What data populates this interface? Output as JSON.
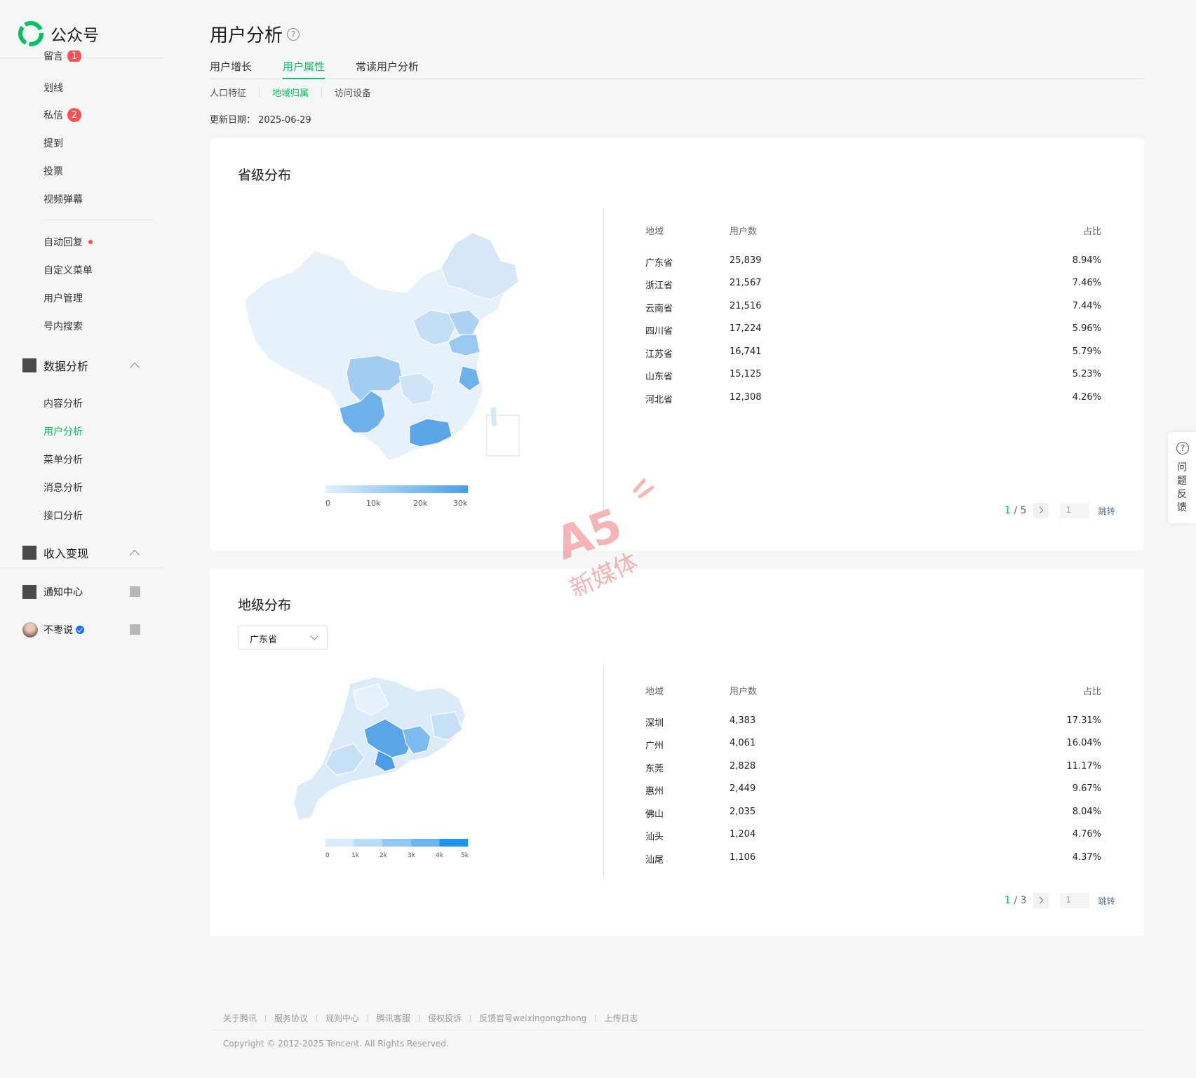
{
  "app": {
    "name": "公众号"
  },
  "sidebar": {
    "items": [
      {
        "label": "留言",
        "badge": "1"
      },
      {
        "label": "划线"
      },
      {
        "label": "私信",
        "badge": "2"
      },
      {
        "label": "提到"
      },
      {
        "label": "投票"
      },
      {
        "label": "视频弹幕"
      },
      {
        "label": "自动回复"
      },
      {
        "label": "自定义菜单"
      },
      {
        "label": "用户管理"
      },
      {
        "label": "号内搜索"
      }
    ],
    "groups": {
      "data_analysis": "数据分析",
      "data_items": [
        "内容分析",
        "用户分析",
        "菜单分析",
        "消息分析",
        "接口分析"
      ],
      "monetize": "收入变现",
      "notice": "通知中心",
      "account": "不枣说"
    }
  },
  "header": {
    "title": "用户分析",
    "help": "?",
    "tabs": [
      "用户增长",
      "用户属性",
      "常读用户分析"
    ],
    "subtabs": [
      "人口特征",
      "地域归属",
      "访问设备"
    ],
    "update_label": "更新日期：",
    "update_date": "2025-06-29"
  },
  "province": {
    "title": "省级分布",
    "columns": [
      "地域",
      "用户数",
      "占比"
    ],
    "rows": [
      {
        "region": "广东省",
        "users": "25,839",
        "pct": "8.94%"
      },
      {
        "region": "浙江省",
        "users": "21,567",
        "pct": "7.46%"
      },
      {
        "region": "云南省",
        "users": "21,516",
        "pct": "7.44%"
      },
      {
        "region": "四川省",
        "users": "17,224",
        "pct": "5.96%"
      },
      {
        "region": "江苏省",
        "users": "16,741",
        "pct": "5.79%"
      },
      {
        "region": "山东省",
        "users": "15,125",
        "pct": "5.23%"
      },
      {
        "region": "河北省",
        "users": "12,308",
        "pct": "4.26%"
      }
    ],
    "legend": [
      "0",
      "10k",
      "20k",
      "30k"
    ],
    "pager": {
      "current": "1",
      "total": "/ 5",
      "input": "1",
      "jump": "跳转"
    }
  },
  "city": {
    "title": "地级分布",
    "select": "广东省",
    "columns": [
      "地域",
      "用户数",
      "占比"
    ],
    "rows": [
      {
        "region": "深圳",
        "users": "4,383",
        "pct": "17.31%"
      },
      {
        "region": "广州",
        "users": "4,061",
        "pct": "16.04%"
      },
      {
        "region": "东莞",
        "users": "2,828",
        "pct": "11.17%"
      },
      {
        "region": "惠州",
        "users": "2,449",
        "pct": "9.67%"
      },
      {
        "region": "佛山",
        "users": "2,035",
        "pct": "8.04%"
      },
      {
        "region": "汕头",
        "users": "1,204",
        "pct": "4.76%"
      },
      {
        "region": "汕尾",
        "users": "1,106",
        "pct": "4.37%"
      }
    ],
    "legend": [
      "0",
      "1k",
      "2k",
      "3k",
      "4k",
      "5k"
    ],
    "pager": {
      "current": "1",
      "total": "/ 3",
      "input": "1",
      "jump": "跳转"
    }
  },
  "footer": {
    "links": [
      "关于腾讯",
      "服务协议",
      "规则中心",
      "腾讯客服",
      "侵权投诉",
      "反馈官号weixingongzhong",
      "上传日志"
    ],
    "copyright": "Copyright © 2012-2025 Tencent. All Rights Reserved."
  },
  "feedback": {
    "label": "问题反馈"
  },
  "watermark": {
    "text": "新媒体"
  },
  "colors": {
    "accent": "#07c160",
    "badge": "#fa5151",
    "map_light": "#e3f0fb",
    "map_dark": "#4a9ee8"
  }
}
